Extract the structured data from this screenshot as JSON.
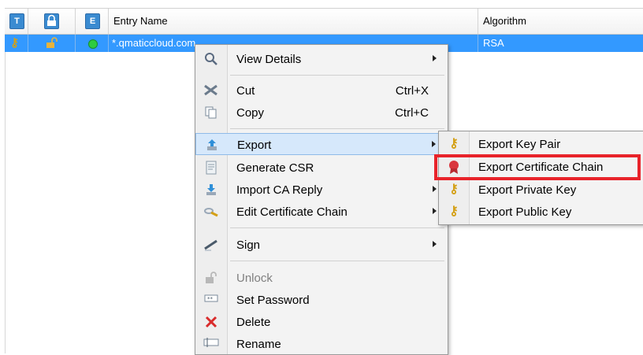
{
  "table": {
    "headers": {
      "type_icon": "T",
      "lock_icon": "",
      "expiry_icon": "E",
      "entry_name": "Entry Name",
      "algorithm": "Algorithm"
    },
    "row": {
      "entry_name": "*.qmaticcloud.com",
      "algorithm": "RSA"
    }
  },
  "context_menu": {
    "items": [
      {
        "label": "View Details",
        "icon": "magnifier-icon",
        "submenu": true
      },
      {
        "label": "Cut",
        "icon": "scissors-icon",
        "shortcut": "Ctrl+X"
      },
      {
        "label": "Copy",
        "icon": "copy-icon",
        "shortcut": "Ctrl+C"
      },
      {
        "label": "Export",
        "icon": "export-icon",
        "submenu": true,
        "highlighted": true
      },
      {
        "label": "Generate CSR",
        "icon": "document-icon"
      },
      {
        "label": "Import CA Reply",
        "icon": "import-icon",
        "submenu": true
      },
      {
        "label": "Edit Certificate Chain",
        "icon": "certificate-chain-icon",
        "submenu": true
      },
      {
        "label": "Sign",
        "icon": "pen-icon",
        "submenu": true
      },
      {
        "label": "Unlock",
        "icon": "unlock-icon",
        "disabled": true
      },
      {
        "label": "Set Password",
        "icon": "password-icon"
      },
      {
        "label": "Delete",
        "icon": "delete-icon"
      },
      {
        "label": "Rename",
        "icon": "rename-icon"
      }
    ]
  },
  "export_submenu": {
    "items": [
      {
        "label": "Export Key Pair",
        "icon": "key-pair-icon"
      },
      {
        "label": "Export Certificate Chain",
        "icon": "certificate-icon",
        "highlighted": true
      },
      {
        "label": "Export Private Key",
        "icon": "private-key-icon"
      },
      {
        "label": "Export Public Key",
        "icon": "public-key-icon"
      }
    ]
  },
  "colors": {
    "selection": "#3399ff",
    "menu_highlight": "#d6e8fb",
    "annotation_box": "#e8232a"
  }
}
